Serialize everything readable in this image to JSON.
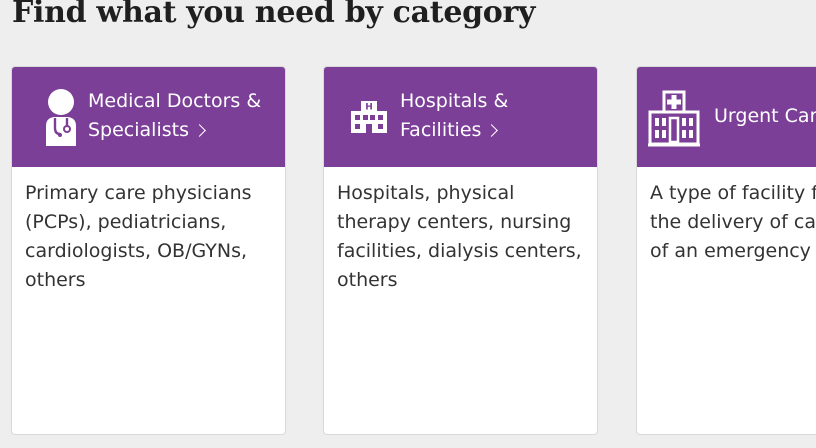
{
  "heading": "Find what you need by category",
  "cards": [
    {
      "icon": "doctor-icon",
      "title_line1": "Medical Doctors &",
      "title_line2": "Specialists",
      "description": "Primary care physicians (PCPs), pediatricians, cardiologists, OB/GYNs, others"
    },
    {
      "icon": "hospital-building-icon",
      "title_line1": "Hospitals &",
      "title_line2": "Facilities",
      "description": "Hospitals, physical therapy centers, nursing facilities, dialysis centers, others"
    },
    {
      "icon": "urgent-care-building-icon",
      "title_line1": "Urgent Care",
      "title_line2": "",
      "description": "A type of facility focused on the delivery of care outside of an emergency room"
    }
  ],
  "colors": {
    "accent": "#7c3f98",
    "background": "#eeeeee",
    "card": "#ffffff",
    "text": "#333333"
  }
}
